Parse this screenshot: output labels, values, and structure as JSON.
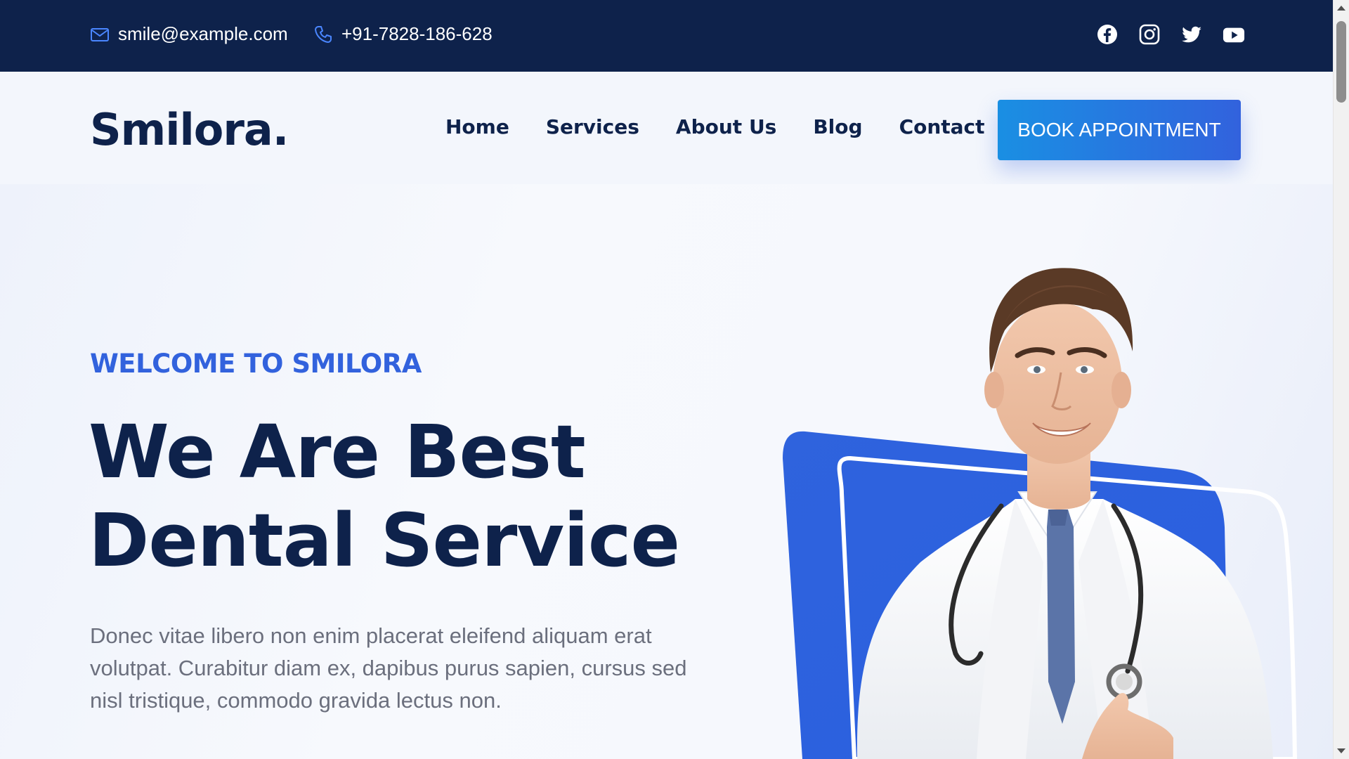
{
  "topbar": {
    "email": "smile@example.com",
    "phone": "+91-7828-186-628",
    "social": [
      "facebook-icon",
      "instagram-icon",
      "twitter-icon",
      "youtube-icon"
    ]
  },
  "header": {
    "logo": "Smilora.",
    "nav": [
      "Home",
      "Services",
      "About Us",
      "Blog",
      "Contact"
    ],
    "cta": "BOOK APPOINTMENT"
  },
  "hero": {
    "eyebrow": "WELCOME TO SMILORA",
    "headline_line1": "We Are Best",
    "headline_line2": "Dental Service",
    "lead": "Donec vitae libero non enim placerat eleifend aliquam erat volutpat. Curabitur diam ex, dapibus purus sapien, cursus sed nisl tristique, commodo gravida lectus non."
  },
  "colors": {
    "navy": "#0e224b",
    "accent": "#3262dd",
    "cta_gradient_start": "#1a8fe3",
    "text_muted": "#6b6f7d"
  }
}
